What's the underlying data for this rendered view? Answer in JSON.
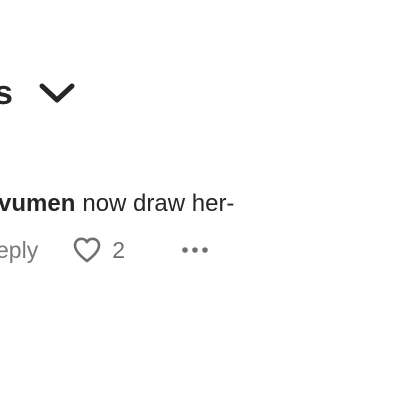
{
  "header": {
    "title_fragment": "s",
    "chevron_icon": "chevron-down-icon"
  },
  "comment": {
    "username": "vumen",
    "text": "now draw her-",
    "reply_label": "eply",
    "like_count": "2",
    "like_icon": "heart-outline-icon",
    "more_icon": "more-options-icon"
  },
  "colors": {
    "background": "#ffffff",
    "text": "#262626",
    "muted": "#7a7a7a"
  }
}
